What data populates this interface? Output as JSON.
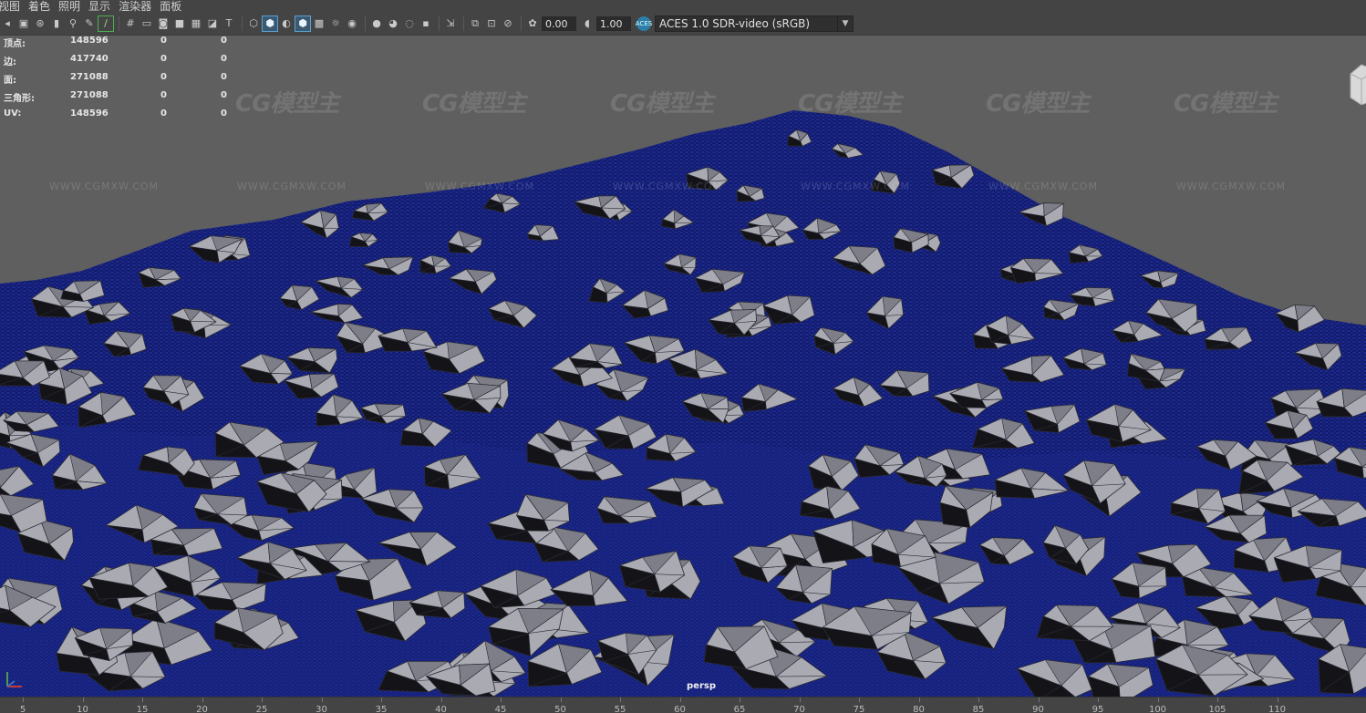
{
  "menu": {
    "items": [
      "视图",
      "着色",
      "照明",
      "显示",
      "渲染器",
      "面板"
    ]
  },
  "toolbar": {
    "exposure": "0.00",
    "gamma": "1.00",
    "colorspace": "ACES 1.0 SDR-video (sRGB)",
    "aces_badge": "ACES"
  },
  "hud": {
    "rows": [
      {
        "label": "顶点:",
        "v1": "148596",
        "v2": "0",
        "v3": "0"
      },
      {
        "label": "边:",
        "v1": "417740",
        "v2": "0",
        "v3": "0"
      },
      {
        "label": "面:",
        "v1": "271088",
        "v2": "0",
        "v3": "0"
      },
      {
        "label": "三角形:",
        "v1": "271088",
        "v2": "0",
        "v3": "0"
      },
      {
        "label": "UV:",
        "v1": "148596",
        "v2": "0",
        "v3": "0"
      }
    ]
  },
  "viewport": {
    "camera": "persp",
    "wireframe_color": "#1a2a8c",
    "rock_color": "#a9aab2",
    "background_color": "#5f5f5f"
  },
  "watermark": {
    "logo": "CG模型主",
    "url": "WWW.CGMXW.COM"
  },
  "timeline": {
    "ticks": [
      "5",
      "10",
      "15",
      "20",
      "25",
      "30",
      "35",
      "40",
      "45",
      "50",
      "55",
      "60",
      "65",
      "70",
      "75",
      "80",
      "85",
      "90",
      "95",
      "100",
      "105",
      "110"
    ]
  }
}
